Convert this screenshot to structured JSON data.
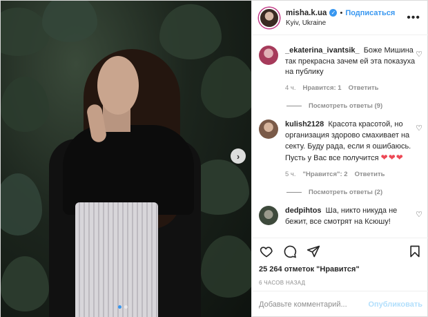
{
  "post": {
    "username": "misha.k.ua",
    "separator": "•",
    "follow_label": "Подписаться",
    "location": "Kyiv, Ukraine",
    "more_icon": "more-options-icon",
    "image": {
      "alt": "photo",
      "slide_count": 2,
      "active_slide": 1
    }
  },
  "comments": [
    {
      "user": "_ekaterina_ivantsik_",
      "text": "Боже Мишина так прекрасна зачем ей эта показуха на публику",
      "time": "4 ч.",
      "likes": "Нравится: 1",
      "reply": "Ответить",
      "view_replies": "Посмотреть ответы (9)"
    },
    {
      "user": "kulish2128",
      "text": "Красота красотой, но организация здорово смахивает на секту. Буду рада, если я ошибаюсь. Пусть у Вас все получится",
      "hearts": "❤❤❤",
      "time": "5 ч.",
      "likes": "\"Нравится\": 2",
      "reply": "Ответить",
      "view_replies": "Посмотреть ответы (2)"
    },
    {
      "user": "dedpihtos",
      "text": "Ша, никто никуда не бежит, все смотрят на Ксюшу!"
    }
  ],
  "actions": {
    "likes_text": "25 264 отметок \"Нравится\"",
    "timestamp": "6 ЧАСОВ НАЗАД"
  },
  "add_comment": {
    "placeholder": "Добавьте комментарий...",
    "publish_label": "Опубликовать"
  },
  "colors": {
    "accent": "#3897f0",
    "heart": "#ed4956",
    "muted": "#8e8e8e",
    "publish_disabled": "#b2dffc"
  }
}
